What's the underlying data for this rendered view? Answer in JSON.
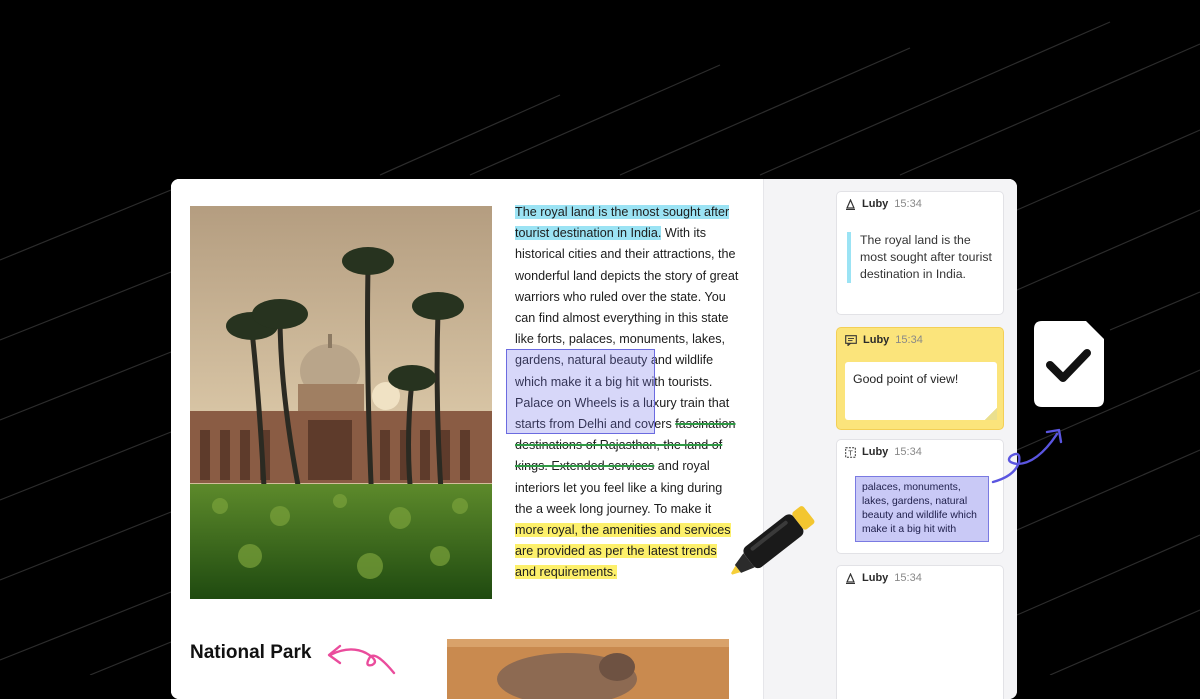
{
  "article": {
    "seg1": "The royal land is the most sought after tourist destination in India.",
    "seg2": " With its historical cities and their attractions, the wonderful land depicts the story of great warriors who ruled over the state. You can find almost everything in this state like ",
    "seg3": "forts, palaces, monuments, lakes, gardens, natural beauty and wildlife which make it a big hit with tourists. Palace on Wheels is a luxury train that starts from Delhi and covers ",
    "seg4": "fascination destinations of Rajasthan, the land of kings. Extended services",
    "seg5": " and royal interiors let you feel like a king during the a week long journey. To make it ",
    "seg6": "more royal, the amenities and services are provided as per the latest trends and requirements."
  },
  "section_title": "National Park",
  "comments": [
    {
      "author": "Luby",
      "time": "15:34",
      "type": "highlight",
      "text": "The royal land is the most sought after tourist destination in India."
    },
    {
      "author": "Luby",
      "time": "15:34",
      "type": "note",
      "text": "Good point of view!"
    },
    {
      "author": "Luby",
      "time": "15:34",
      "type": "area",
      "text": "palaces, monuments, lakes, gardens, natural beauty and wildlife which make it a big hit with"
    },
    {
      "author": "Luby",
      "time": "15:34",
      "type": "stamp",
      "text": ""
    }
  ],
  "colors": {
    "highlight_blue": "#9be3f4",
    "highlight_yellow": "#fdf06b",
    "area_purple": "#6b6be0",
    "strike_green": "#2f9a45",
    "note_yellow": "#fbe47b",
    "arrow_blue": "#5a55e0",
    "arrow_pink": "#ea4c9c"
  },
  "icons": [
    "pen-icon",
    "comment-icon",
    "area-select-icon",
    "checkmark-icon",
    "highlighter-marker-icon"
  ]
}
